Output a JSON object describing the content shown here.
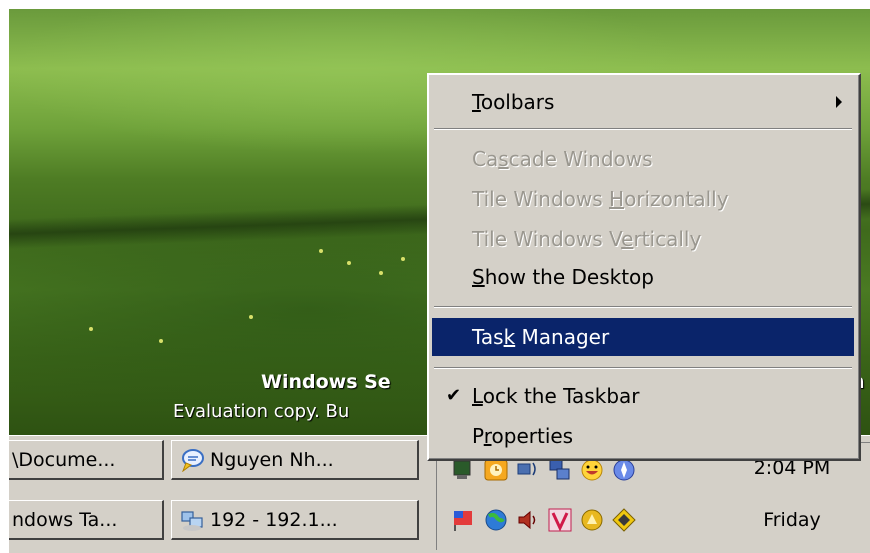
{
  "desktop": {
    "watermark_title": "Windows Se",
    "watermark_subtitle": "Evaluation copy. Bu",
    "watermark_title_right": "n",
    "watermark_subtitle_right": ")"
  },
  "taskbar": {
    "buttons": [
      {
        "label": "\\Docume...",
        "icon": "folder-icon"
      },
      {
        "label": "Nguyen Nh...",
        "icon": "chat-bubble-icon"
      },
      {
        "label": "ndows Ta...",
        "icon": "window-icon"
      },
      {
        "label": "192 - 192.1...",
        "icon": "network-computers-icon"
      }
    ],
    "tray": {
      "time": "2:04 PM",
      "day": "Friday",
      "icons": [
        "monitor-icon",
        "clock-app-icon",
        "sound-network-icon",
        "network-icon",
        "smiley-icon",
        "compass-icon",
        "flag-icon",
        "globe-icon",
        "speaker-icon",
        "antivirus-v-icon",
        "gold-app-icon",
        "diamond-app-icon"
      ]
    }
  },
  "context_menu": {
    "items": [
      {
        "label": "Toolbars",
        "accel": "T",
        "state": "normal",
        "submenu": true
      },
      {
        "label": "Cascade Windows",
        "accel": "s",
        "state": "disabled"
      },
      {
        "label": "Tile Windows Horizontally",
        "accel": "H",
        "state": "disabled"
      },
      {
        "label": "Tile Windows Vertically",
        "accel": "e",
        "state": "disabled"
      },
      {
        "label": "Show the Desktop",
        "accel": "S",
        "state": "normal"
      },
      {
        "label": "Task Manager",
        "accel": "k",
        "state": "selected"
      },
      {
        "label": "Lock the Taskbar",
        "accel": "L",
        "state": "checked"
      },
      {
        "label": "Properties",
        "accel": "r",
        "state": "normal"
      }
    ]
  },
  "colors": {
    "menu_bg": "#d4d0c8",
    "selection": "#0a246a",
    "disabled_text": "#9a978f"
  }
}
